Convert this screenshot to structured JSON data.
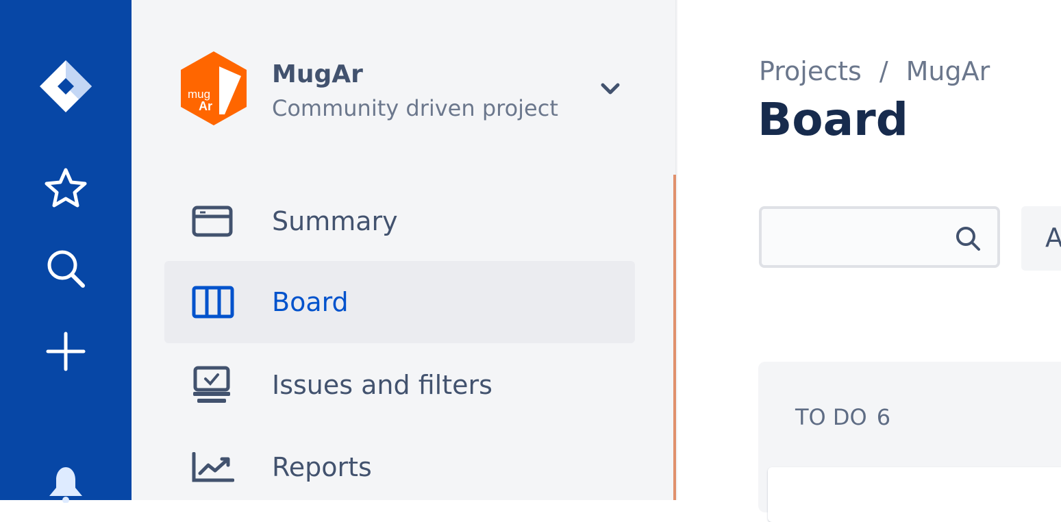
{
  "project": {
    "name": "MugAr",
    "subtitle": "Community driven project",
    "logo_text_top": "mug",
    "logo_text_bottom": "Ar"
  },
  "global_nav": {
    "icons": [
      "jira-logo-icon",
      "star-icon",
      "search-icon",
      "plus-icon",
      "bell-icon"
    ]
  },
  "sidebar": {
    "items": [
      {
        "label": "Summary",
        "icon": "summary-icon",
        "selected": false
      },
      {
        "label": "Board",
        "icon": "board-icon",
        "selected": true
      },
      {
        "label": "Issues and filters",
        "icon": "issues-icon",
        "selected": false
      },
      {
        "label": "Reports",
        "icon": "reports-icon",
        "selected": false
      }
    ]
  },
  "breadcrumb": {
    "root": "Projects",
    "separator": "/",
    "current": "MugAr"
  },
  "page": {
    "title": "Board"
  },
  "search": {
    "value": "",
    "placeholder": ""
  },
  "filter": {
    "label": "A"
  },
  "columns": [
    {
      "name": "TO DO",
      "count": "6"
    }
  ],
  "colors": {
    "global_nav": "#0747a6",
    "sidebar_bg": "#f4f5f7",
    "selected_text": "#0052cc",
    "logo": "#ff6600",
    "title": "#172b4d"
  }
}
